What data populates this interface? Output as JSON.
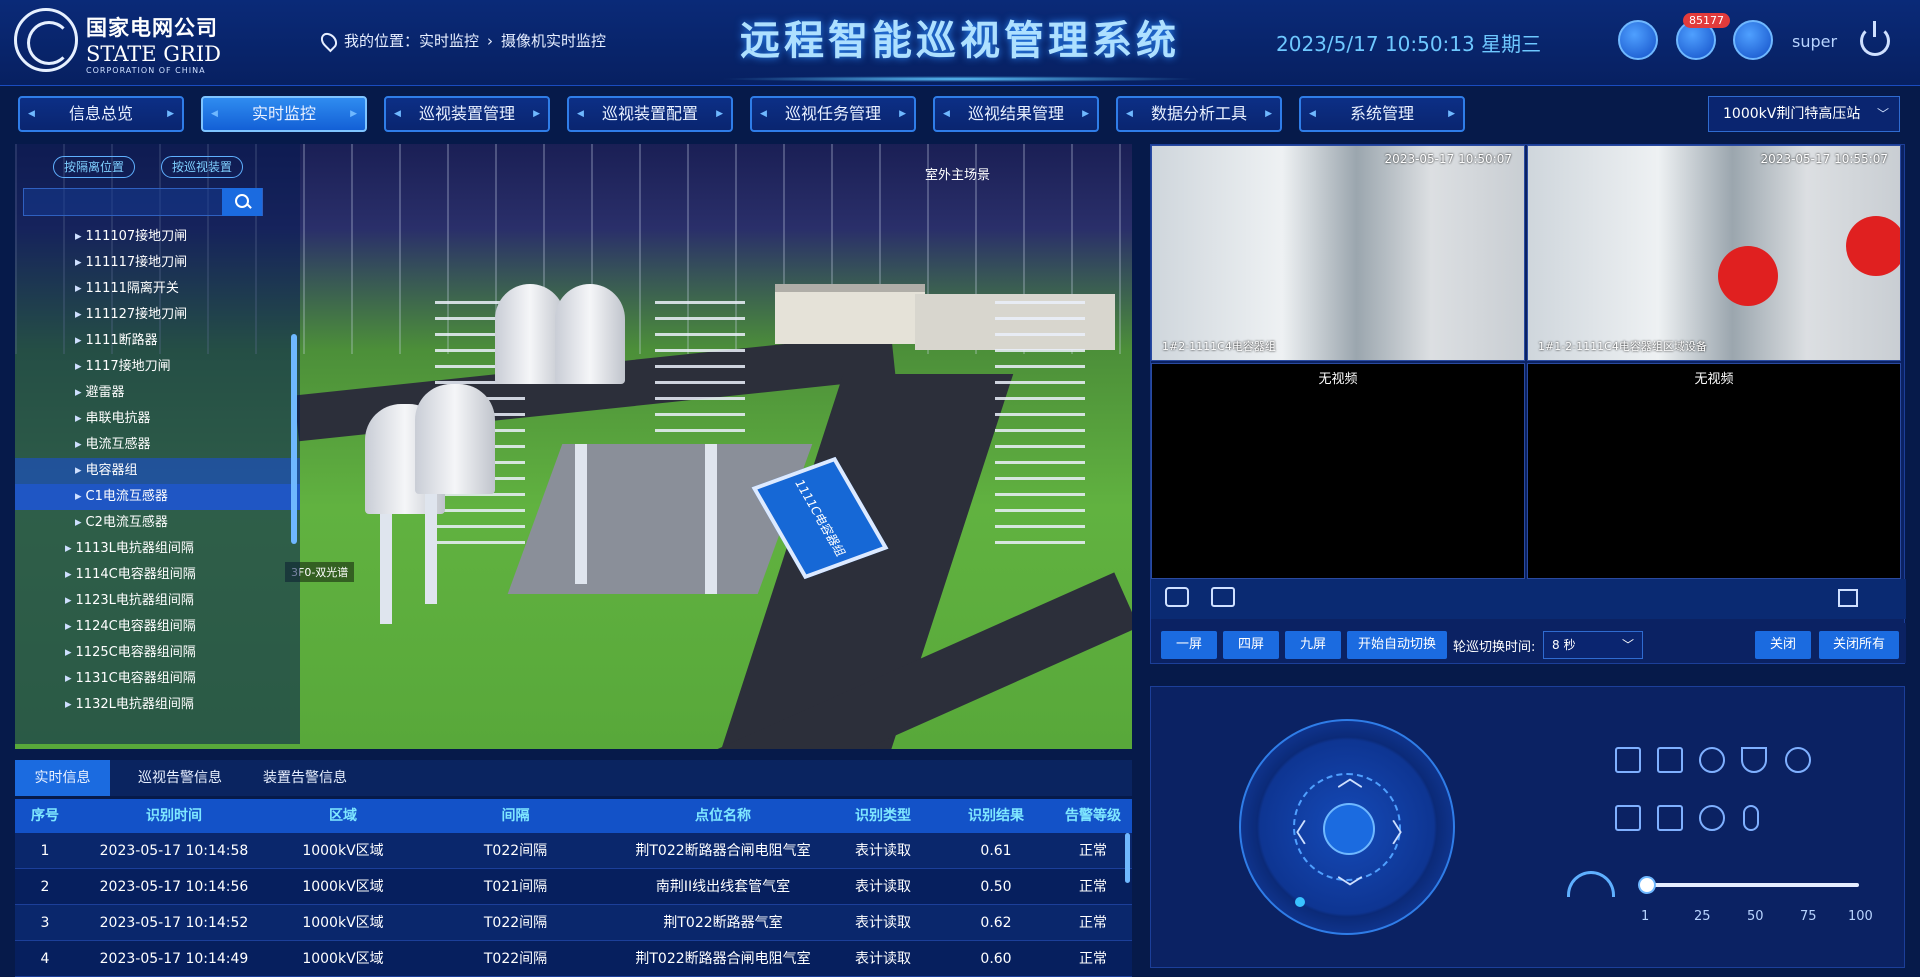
{
  "header": {
    "logo_cn": "国家电网公司",
    "logo_en": "STATE GRID",
    "logo_sub": "CORPORATION OF CHINA",
    "location_prefix": "我的位置：",
    "location_path": "实时监控",
    "location_sep": "›",
    "location_current": "摄像机实时监控",
    "title": "远程智能巡视管理系统",
    "datetime": "2023/5/17 10:50:13 星期三",
    "notification_count": "85177",
    "username": "super",
    "icons": [
      "weather-icon",
      "bell-icon",
      "user-icon",
      "power-icon",
      "pin-icon"
    ]
  },
  "nav": {
    "items": [
      "信息总览",
      "实时监控",
      "巡视装置管理",
      "巡视装置配置",
      "巡视任务管理",
      "巡视结果管理",
      "数据分析工具",
      "系统管理"
    ],
    "active_index": 1,
    "station": "1000kV荆门特高压站"
  },
  "scene": {
    "label": "室外主场景",
    "tag": "3F0-双光谱",
    "sign_text": "1111C电容器组",
    "tools": [
      "refresh-icon",
      "fullscreen-icon",
      "layer-icon",
      "ruler-icon"
    ]
  },
  "tree": {
    "tabs": [
      "按隔离位置",
      "按巡视装置"
    ],
    "search_placeholder": "",
    "items": [
      {
        "label": "111107接地刀闸",
        "indent": 2
      },
      {
        "label": "111117接地刀闸",
        "indent": 2
      },
      {
        "label": "11111隔离开关",
        "indent": 2
      },
      {
        "label": "111127接地刀闸",
        "indent": 2
      },
      {
        "label": "1111断路器",
        "indent": 2
      },
      {
        "label": "1117接地刀闸",
        "indent": 2
      },
      {
        "label": "避雷器",
        "indent": 2
      },
      {
        "label": "串联电抗器",
        "indent": 2
      },
      {
        "label": "电流互感器",
        "indent": 2
      },
      {
        "label": "电容器组",
        "indent": 2
      },
      {
        "label": "C1电流互感器",
        "indent": 2
      },
      {
        "label": "C2电流互感器",
        "indent": 2
      },
      {
        "label": "1113L电抗器组间隔",
        "indent": 1
      },
      {
        "label": "1114C电容器组间隔",
        "indent": 1
      },
      {
        "label": "1123L电抗器组间隔",
        "indent": 1
      },
      {
        "label": "1124C电容器组间隔",
        "indent": 1
      },
      {
        "label": "1125C电容器组间隔",
        "indent": 1
      },
      {
        "label": "1131C电容器组间隔",
        "indent": 1
      },
      {
        "label": "1132L电抗器组间隔",
        "indent": 1
      }
    ],
    "highlight_index": 9,
    "selected_index": 10
  },
  "info": {
    "tabs": [
      "实时信息",
      "巡视告警信息",
      "装置告警信息"
    ],
    "active_tab": 0,
    "columns": [
      "序号",
      "识别时间",
      "区域",
      "间隔",
      "点位名称",
      "识别类型",
      "识别结果",
      "告警等级"
    ],
    "rows": [
      [
        "1",
        "2023-05-17 10:14:58",
        "1000kV区域",
        "T022间隔",
        "荆T022断路器合闸电阻气室",
        "表计读取",
        "0.61",
        "正常"
      ],
      [
        "2",
        "2023-05-17 10:14:56",
        "1000kV区域",
        "T021间隔",
        "南荆II线出线套管气室",
        "表计读取",
        "0.50",
        "正常"
      ],
      [
        "3",
        "2023-05-17 10:14:52",
        "1000kV区域",
        "T022间隔",
        "荆T022断路器气室",
        "表计读取",
        "0.62",
        "正常"
      ],
      [
        "4",
        "2023-05-17 10:14:49",
        "1000kV区域",
        "T022间隔",
        "荆T022断路器合闸电阻气室",
        "表计读取",
        "0.60",
        "正常"
      ]
    ]
  },
  "video": {
    "cells": [
      {
        "type": "camera",
        "stamp": "2023-05-17 10:50:07",
        "caption": "1#2-1111C4电容器组"
      },
      {
        "type": "camera",
        "stamp": "2023-05-17 10:55:07",
        "caption": "1#1-2-1111C4电容器组区域设备"
      },
      {
        "type": "empty",
        "text": "无视频"
      },
      {
        "type": "empty",
        "text": "无视频"
      }
    ],
    "buttons": [
      "一屏",
      "四屏",
      "九屏",
      "开始自动切换"
    ],
    "rotate_label": "轮巡切换时间:",
    "rotate_value": "8 秒",
    "close_label": "关闭",
    "close_all_label": "关闭所有",
    "icons": [
      "camera-icon",
      "record-icon",
      "fullscreen-icon"
    ]
  },
  "ptz": {
    "speed_ticks": [
      "1",
      "25",
      "50",
      "75",
      "100"
    ],
    "speed_value": 1,
    "icons": [
      "zoom-in-icon",
      "copy-icon",
      "focus-icon",
      "wiper-icon",
      "light-icon",
      "zoom-out-icon",
      "copy2-icon",
      "focus-out-icon",
      "mic-icon",
      "gauge-icon"
    ]
  }
}
